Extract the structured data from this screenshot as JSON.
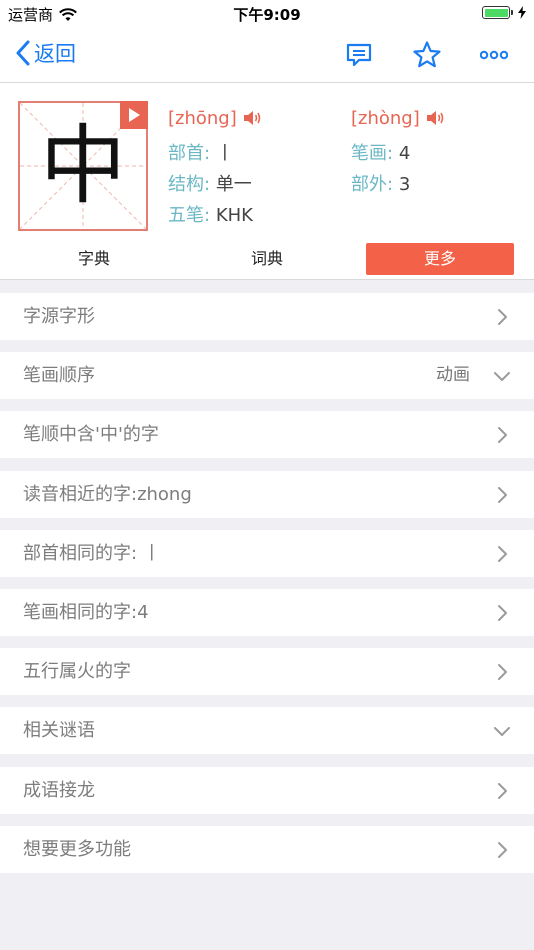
{
  "status_bar": {
    "carrier": "运营商",
    "time": "下午9:09"
  },
  "nav": {
    "back_label": "返回"
  },
  "character": {
    "glyph": "中",
    "pinyin_1": "[zhōng]",
    "pinyin_2": "[zhòng]",
    "radical_label": "部首:",
    "radical_value": "丨",
    "strokes_label": "笔画:",
    "strokes_value": "4",
    "structure_label": "结构:",
    "structure_value": "单一",
    "outer_label": "部外:",
    "outer_value": "3",
    "wubi_label": "五笔:",
    "wubi_value": "KHK"
  },
  "tabs": [
    {
      "label": "字典"
    },
    {
      "label": "词典"
    },
    {
      "label": "更多"
    }
  ],
  "active_tab": "更多",
  "rows": [
    {
      "label": "字源字形",
      "extra": "",
      "arrow": "right"
    },
    {
      "label": "笔画顺序",
      "extra": "动画",
      "arrow": "down"
    },
    {
      "label": "笔顺中含'中'的字",
      "extra": "",
      "arrow": "right"
    },
    {
      "label": "读音相近的字:zhong",
      "extra": "",
      "arrow": "right"
    },
    {
      "label": "部首相同的字: 丨",
      "extra": "",
      "arrow": "right"
    },
    {
      "label": "笔画相同的字:4",
      "extra": "",
      "arrow": "right"
    },
    {
      "label": "五行属火的字",
      "extra": "",
      "arrow": "right"
    },
    {
      "label": "相关谜语",
      "extra": "",
      "arrow": "down"
    },
    {
      "label": "成语接龙",
      "extra": "",
      "arrow": "right"
    },
    {
      "label": "想要更多功能",
      "extra": "",
      "arrow": "right"
    }
  ],
  "colors": {
    "accent_blue": "#1a7cf0",
    "accent_red": "#f26148",
    "label_teal": "#6bb8c4"
  }
}
